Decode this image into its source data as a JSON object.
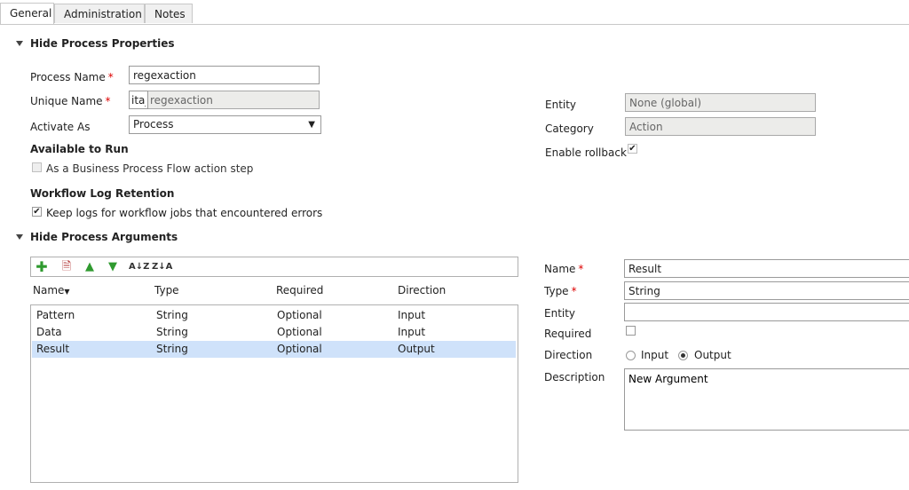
{
  "tabs": [
    "General",
    "Administration",
    "Notes"
  ],
  "properties": {
    "header": "Hide Process Properties",
    "process_name_label": "Process Name",
    "process_name_value": "regexaction",
    "unique_name_label": "Unique Name",
    "unique_name_prefix": "ita_",
    "unique_name_value": "regexaction",
    "activate_as_label": "Activate As",
    "activate_as_value": "Process",
    "available_header": "Available to Run",
    "bpf_label": "As a Business Process Flow action step",
    "log_header": "Workflow Log Retention",
    "log_label": "Keep logs for workflow jobs that encountered errors",
    "entity_label": "Entity",
    "entity_value": "None (global)",
    "category_label": "Category",
    "category_value": "Action",
    "rollback_label": "Enable rollback"
  },
  "arguments": {
    "header": "Hide Process Arguments",
    "columns": [
      "Name",
      "Type",
      "Required",
      "Direction"
    ],
    "rows": [
      {
        "name": "Pattern",
        "type": "String",
        "required": "Optional",
        "direction": "Input"
      },
      {
        "name": "Data",
        "type": "String",
        "required": "Optional",
        "direction": "Input"
      },
      {
        "name": "Result",
        "type": "String",
        "required": "Optional",
        "direction": "Output"
      }
    ],
    "toolbar_icons": [
      "add-icon",
      "delete-icon",
      "move-up-icon",
      "move-down-icon",
      "sort-ascending-icon",
      "sort-descending-icon"
    ]
  },
  "detail": {
    "name_label": "Name",
    "name_value": "Result",
    "type_label": "Type",
    "type_value": "String",
    "entity_label": "Entity",
    "entity_value": "",
    "required_label": "Required",
    "direction_label": "Direction",
    "direction_input": "Input",
    "direction_output": "Output",
    "description_label": "Description",
    "description_value": "New Argument"
  }
}
